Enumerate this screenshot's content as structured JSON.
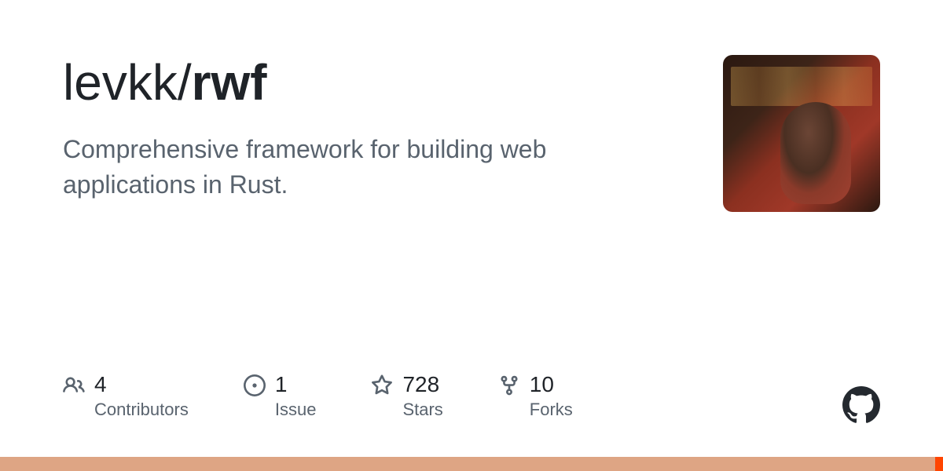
{
  "repo": {
    "owner": "levkk",
    "separator": "/",
    "name": "rwf",
    "description": "Comprehensive framework for building web applications in Rust."
  },
  "stats": {
    "contributors": {
      "value": "4",
      "label": "Contributors"
    },
    "issues": {
      "value": "1",
      "label": "Issue"
    },
    "stars": {
      "value": "728",
      "label": "Stars"
    },
    "forks": {
      "value": "10",
      "label": "Forks"
    }
  }
}
